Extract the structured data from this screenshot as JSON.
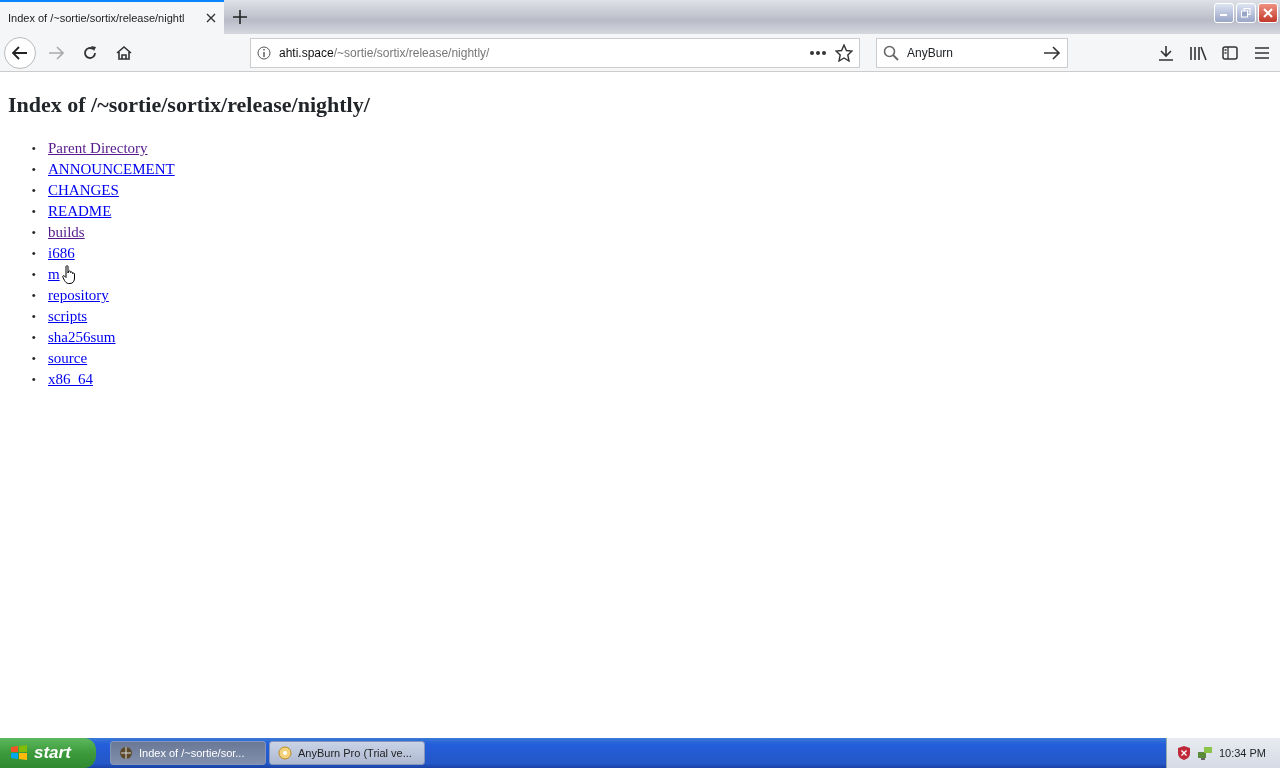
{
  "tabs": [
    {
      "label": "Index of /~sortie/sortix/release/nightl",
      "selected": true
    }
  ],
  "address_bar": {
    "host": "ahti.space",
    "path": "/~sortie/sortix/release/nightly/"
  },
  "search": {
    "value": "AnyBurn"
  },
  "page": {
    "heading": "Index of /~sortie/sortix/release/nightly/",
    "bullet": "•",
    "links": [
      {
        "label": "Parent Directory",
        "visited": true
      },
      {
        "label": "ANNOUNCEMENT",
        "visited": false
      },
      {
        "label": "CHANGES",
        "visited": false
      },
      {
        "label": "README",
        "visited": false
      },
      {
        "label": "builds",
        "visited": true
      },
      {
        "label": "i686",
        "visited": false
      },
      {
        "label": "m",
        "visited": false
      },
      {
        "label": "repository",
        "visited": false
      },
      {
        "label": "scripts",
        "visited": false
      },
      {
        "label": "sha256sum",
        "visited": false
      },
      {
        "label": "source",
        "visited": false
      },
      {
        "label": "x86_64",
        "visited": false
      }
    ]
  },
  "taskbar": {
    "start": "start",
    "tasks": [
      {
        "label": "Index of /~sortie/sor...",
        "selected": true,
        "kind": "browser"
      },
      {
        "label": "AnyBurn Pro (Trial ve...",
        "selected": false,
        "kind": "disc"
      }
    ],
    "clock": "10:34 PM"
  }
}
